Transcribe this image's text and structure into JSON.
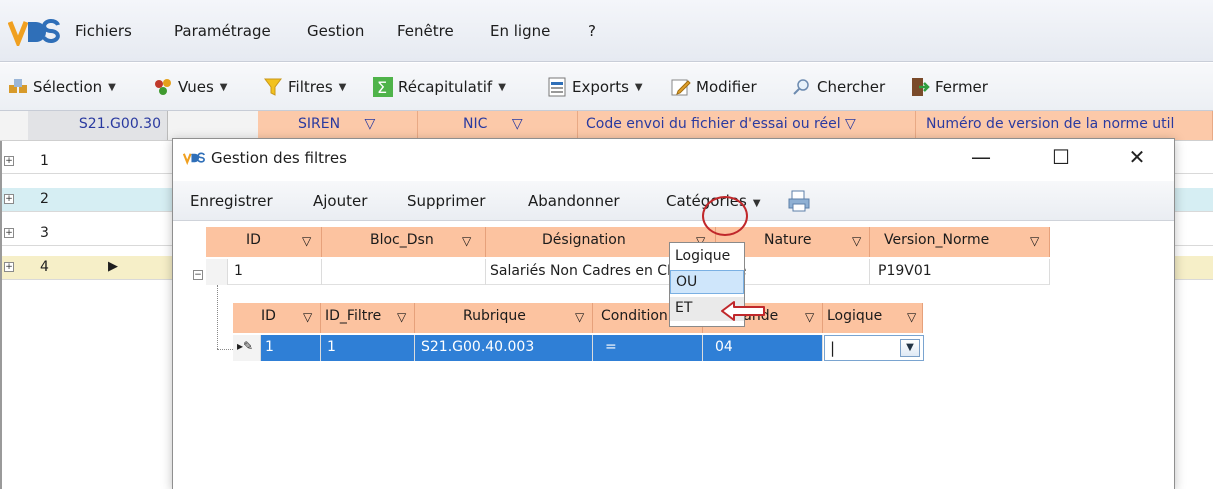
{
  "app": {
    "logo_text": "VDS",
    "menu": [
      "Fichiers",
      "Paramétrage",
      "Gestion",
      "Fenêtre",
      "En ligne",
      "?"
    ]
  },
  "toolbar": {
    "selection": "Sélection",
    "vues": "Vues",
    "filtres": "Filtres",
    "recap": "Récapitulatif",
    "exports": "Exports",
    "modifier": "Modifier",
    "chercher": "Chercher",
    "fermer": "Fermer"
  },
  "main_grid": {
    "headers": [
      "S21.G00.30",
      "SIREN",
      "NIC",
      "Code envoi du fichier d'essai ou réel",
      "Numéro de version de la norme util"
    ],
    "rows": [
      "1",
      "2",
      "3",
      "4"
    ],
    "colors": {
      "row2": "#d6eef3",
      "row4": "#f6efc8"
    }
  },
  "dialog": {
    "title": "Gestion des filtres",
    "toolbar": {
      "enregistrer": "Enregistrer",
      "ajouter": "Ajouter",
      "supprimer": "Supprimer",
      "abandonner": "Abandonner",
      "categories": "Catégories"
    },
    "filters": {
      "headers": [
        "ID",
        "Bloc_Dsn",
        "Désignation",
        "Nature",
        "Version_Norme"
      ],
      "row": {
        "id": "1",
        "bloc": "",
        "designation": "Salariés Non Cadres en CDI",
        "nature": "Spe",
        "version": "P19V01"
      }
    },
    "conditions": {
      "headers": [
        "ID",
        "ID_Filtre",
        "Rubrique",
        "Condition",
        "Opérande",
        "Logique"
      ],
      "row": {
        "id": "1",
        "id_filtre": "1",
        "rubrique": "S21.G00.40.003",
        "condition": "=",
        "operande": "04",
        "logique": ""
      }
    },
    "logique_options": [
      "Logique",
      "OU",
      "ET"
    ]
  }
}
